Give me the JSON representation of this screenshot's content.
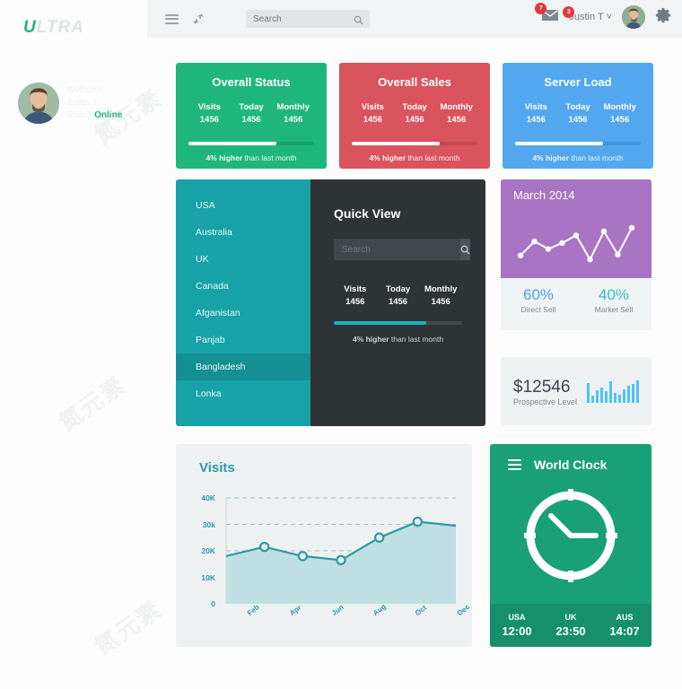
{
  "brand": {
    "accent_letter": "U",
    "rest": "LTRA"
  },
  "topbar": {
    "icons": [
      "menu-icon",
      "refresh-icon",
      "grid-icon"
    ],
    "search": {
      "placeholder": "Search",
      "value": ""
    },
    "mail_badge": "7",
    "user_badge": "3",
    "username": "Justin T",
    "caret": "˅"
  },
  "profile": {
    "welcome": "Welcome",
    "name": "Justin T",
    "status_label": "Status",
    "status_value": "Online"
  },
  "stats": [
    {
      "title": "Overall Status",
      "color": "#1fb67d",
      "columns": [
        {
          "label": "Visits",
          "value": "1456"
        },
        {
          "label": "Today",
          "value": "1456"
        },
        {
          "label": "Monthly",
          "value": "1456"
        }
      ],
      "progress": 70,
      "footnote_bold": "4% higher",
      "footnote_rest": " than last month"
    },
    {
      "title": "Overall Sales",
      "color": "#d9545c",
      "columns": [
        {
          "label": "Visits",
          "value": "1456"
        },
        {
          "label": "Today",
          "value": "1456"
        },
        {
          "label": "Monthly",
          "value": "1456"
        }
      ],
      "progress": 70,
      "footnote_bold": "4% higher",
      "footnote_rest": " than last month"
    },
    {
      "title": "Server Load",
      "color": "#52a7ee",
      "columns": [
        {
          "label": "Visits",
          "value": "1456"
        },
        {
          "label": "Today",
          "value": "1456"
        },
        {
          "label": "Monthly",
          "value": "1456"
        }
      ],
      "progress": 70,
      "footnote_bold": "4% higher",
      "footnote_rest": " than last month"
    }
  ],
  "countries": {
    "items": [
      "USA",
      "Australia",
      "UK",
      "Canada",
      "Afganistan",
      "Panjab",
      "Bangladesh",
      "Lonka"
    ],
    "active_index": 6
  },
  "quickview": {
    "title": "Quick View",
    "search": {
      "placeholder": "Search",
      "value": ""
    },
    "columns": [
      {
        "label": "Visits",
        "value": "1456"
      },
      {
        "label": "Today",
        "value": "1456"
      },
      {
        "label": "Monthly",
        "value": "1456"
      }
    ],
    "progress": 72,
    "footnote_bold": "4% higher",
    "footnote_rest": " than last month"
  },
  "month_card": {
    "title": "March 2014",
    "color": "#a874c3",
    "direct": {
      "pct": "60%",
      "caption": "Direct Sell",
      "color": "#4da3dd"
    },
    "market": {
      "pct": "40%",
      "caption": "Market Sell",
      "color": "#2fbfbf"
    }
  },
  "prospective": {
    "amount": "$12546",
    "caption": "Prospective Level",
    "color": "#4fc3f7"
  },
  "world_clock": {
    "title": "World Clock",
    "menu_icon": "menu-icon",
    "clock_icon": "clock-icon",
    "zones": [
      {
        "zone": "USA",
        "time": "12:00"
      },
      {
        "zone": "UK",
        "time": "23:50"
      },
      {
        "zone": "AUS",
        "time": "14:07"
      }
    ]
  },
  "chart_data": [
    {
      "type": "area",
      "title": "Visits",
      "x": [
        "Feb",
        "Apr",
        "Jun",
        "Aug",
        "Oct",
        "Dec"
      ],
      "xlabel": "",
      "ylabel": "",
      "yticks": [
        "0",
        "10K",
        "20K",
        "30k",
        "40K"
      ],
      "ylim": [
        0,
        40000
      ],
      "values": [
        18000,
        21500,
        18000,
        16500,
        25000,
        31000,
        29500
      ],
      "point_count": 7,
      "line_color": "#2a9aa8",
      "fill_color": "#bfdfe2",
      "grid": true,
      "legend": "none"
    },
    {
      "type": "line",
      "title": "March 2014",
      "values": [
        20,
        48,
        33,
        45,
        60,
        12,
        68,
        22,
        75
      ],
      "ylim": [
        0,
        100
      ],
      "line_color": "#ffffff",
      "grid": false,
      "legend": "none"
    },
    {
      "type": "bar",
      "title": "Prospective Level",
      "values": [
        22,
        8,
        14,
        17,
        13,
        24,
        11,
        9,
        15,
        19,
        21,
        25
      ],
      "ylim": [
        0,
        26
      ],
      "bar_color": "#4fc3f7",
      "grid": false,
      "legend": "none"
    }
  ],
  "watermarks": [
    "氮元素",
    "氮元素",
    "氮元素",
    "氮元素",
    "氮元素",
    "氮元素"
  ]
}
